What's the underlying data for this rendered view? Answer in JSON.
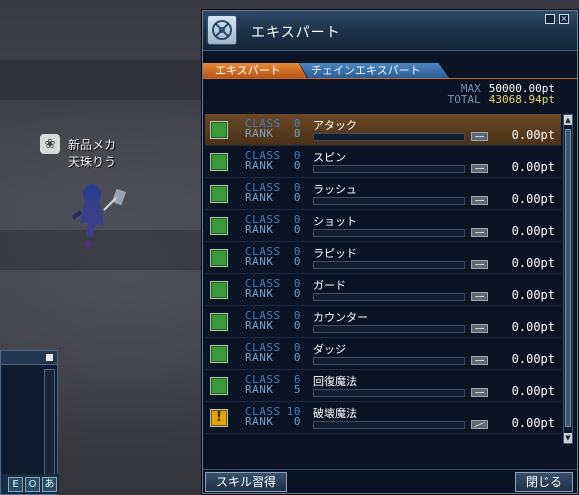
{
  "world": {
    "player_name_line1": "新品メカ",
    "player_name_line2": "天珠りう",
    "player_badge_icon": "lotus-icon"
  },
  "mini_window": {
    "buttons": [
      "E",
      "O",
      "あ"
    ]
  },
  "panel": {
    "title": "エキスパート",
    "tabs": [
      {
        "label": "エキスパート",
        "active": true
      },
      {
        "label": "チェインエキスパート",
        "active": false
      }
    ],
    "max_label": "MAX",
    "max_value": "50000.00pt",
    "total_label": "TOTAL",
    "total_value": "43068.94pt",
    "class_label": "CLASS",
    "rank_label": "RANK",
    "skills": [
      {
        "name": "アタック",
        "class": "0",
        "rank": "0",
        "points": "0.00pt",
        "state": "learned",
        "selected": true
      },
      {
        "name": "スピン",
        "class": "0",
        "rank": "0",
        "points": "0.00pt",
        "state": "learned",
        "selected": false
      },
      {
        "name": "ラッシュ",
        "class": "0",
        "rank": "0",
        "points": "0.00pt",
        "state": "learned",
        "selected": false
      },
      {
        "name": "ショット",
        "class": "0",
        "rank": "0",
        "points": "0.00pt",
        "state": "learned",
        "selected": false
      },
      {
        "name": "ラピッド",
        "class": "0",
        "rank": "0",
        "points": "0.00pt",
        "state": "learned",
        "selected": false
      },
      {
        "name": "ガード",
        "class": "0",
        "rank": "0",
        "points": "0.00pt",
        "state": "learned",
        "selected": false
      },
      {
        "name": "カウンター",
        "class": "0",
        "rank": "0",
        "points": "0.00pt",
        "state": "learned",
        "selected": false
      },
      {
        "name": "ダッジ",
        "class": "0",
        "rank": "0",
        "points": "0.00pt",
        "state": "learned",
        "selected": false
      },
      {
        "name": "回復魔法",
        "class": "6",
        "rank": "5",
        "points": "0.00pt",
        "state": "learned",
        "selected": false
      },
      {
        "name": "破壊魔法",
        "class": "10",
        "rank": "0",
        "points": "0.00pt",
        "state": "warning",
        "selected": false
      }
    ],
    "learn_button": "スキル習得",
    "close_button": "閉じる",
    "colors": {
      "accent_tab": "#d9772c",
      "chain_tab": "#3d74ad",
      "total": "#f1d46a",
      "check": "#3a9a3a",
      "warn": "#e2a313"
    }
  }
}
